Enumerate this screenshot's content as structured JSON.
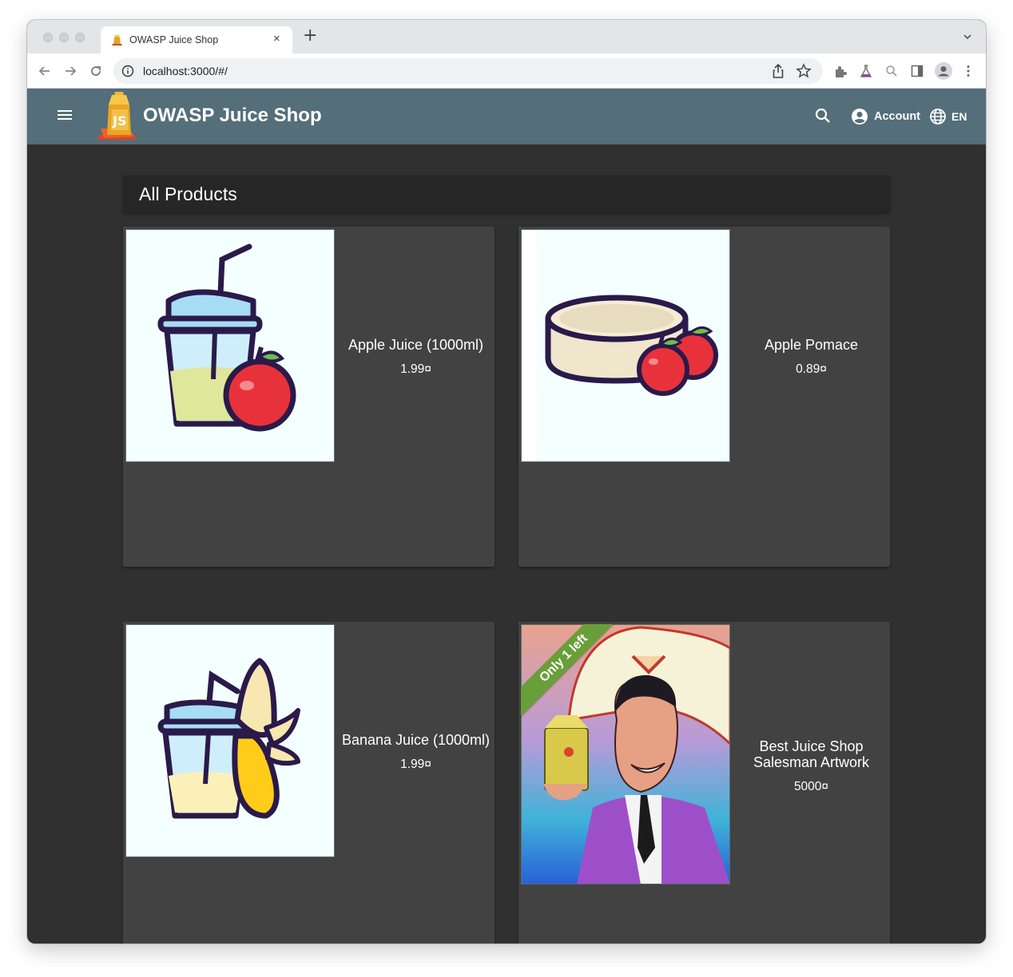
{
  "browser": {
    "tab_title": "OWASP Juice Shop",
    "tab_close_icon": "×",
    "new_tab_icon": "+",
    "url": "localhost:3000/#/"
  },
  "header": {
    "title": "OWASP Juice Shop",
    "account_label": "Account",
    "language_label": "EN",
    "bar_color": "#546e7a"
  },
  "main": {
    "heading": "All Products",
    "products": [
      {
        "name": "Apple Juice (1000ml)",
        "price": "1.99¤",
        "image_icon": "apple-juice-icon"
      },
      {
        "name": "Apple Pomace",
        "price": "0.89¤",
        "image_icon": "apple-pomace-icon"
      },
      {
        "name": "Banana Juice (1000ml)",
        "price": "1.99¤",
        "image_icon": "banana-juice-icon"
      },
      {
        "name": "Best Juice Shop Salesman Artwork",
        "price": "5000¤",
        "image_icon": "salesman-artwork",
        "badge": "Only 1 left",
        "badge_color": "#689f38"
      }
    ]
  }
}
